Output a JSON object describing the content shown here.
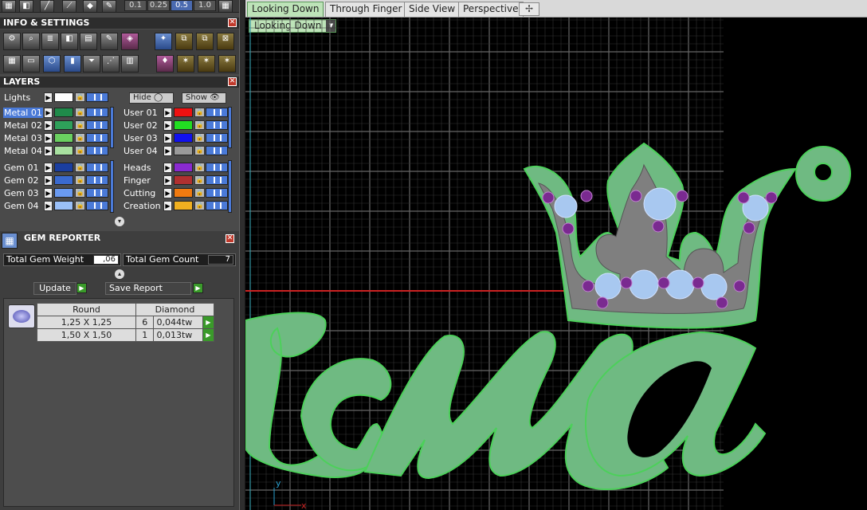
{
  "toolbar": {
    "zoom": [
      "0.1",
      "0.25",
      "0.5",
      "1.0"
    ],
    "zoom_selected": "0.5"
  },
  "info_settings": {
    "title": "INFO & SETTINGS",
    "close": "✕"
  },
  "layers": {
    "title": "LAYERS",
    "close": "✕",
    "lights_label": "Lights",
    "hide_label": "Hide",
    "show_label": "Show",
    "left": [
      {
        "label": "Metal 01",
        "color": "#1f8a4a",
        "selected": true
      },
      {
        "label": "Metal 02",
        "color": "#2ea05a"
      },
      {
        "label": "Metal 03",
        "color": "#6ad060"
      },
      {
        "label": "Metal 04",
        "color": "#a8e0a0"
      },
      {
        "label": "Gem 01",
        "color": "#1a3ea0"
      },
      {
        "label": "Gem 02",
        "color": "#3a6ad0"
      },
      {
        "label": "Gem 03",
        "color": "#6a9af0"
      },
      {
        "label": "Gem 04",
        "color": "#9ac0f8"
      }
    ],
    "right": [
      {
        "label": "User 01",
        "color": "#ee1111"
      },
      {
        "label": "User 02",
        "color": "#22dd22"
      },
      {
        "label": "User 03",
        "color": "#1111ee"
      },
      {
        "label": "User 04",
        "color": "#9a9a9a"
      },
      {
        "label": "Heads",
        "color": "#8a2ad0"
      },
      {
        "label": "Finger",
        "color": "#b03030"
      },
      {
        "label": "Cutting",
        "color": "#f07a10"
      },
      {
        "label": "Creation",
        "color": "#f0b020"
      }
    ]
  },
  "gem_reporter": {
    "title": "GEM REPORTER",
    "close": "✕",
    "weight_label": "Total Gem Weight",
    "weight_value": ",06",
    "count_label": "Total Gem Count",
    "count_value": "7",
    "update_label": "Update",
    "save_label": "Save Report",
    "table_headers": [
      "Round",
      "Diamond"
    ],
    "rows": [
      {
        "size": "1,25 X 1,25",
        "count": "6",
        "weight": "0,044tw"
      },
      {
        "size": "1,50 X 1,50",
        "count": "1",
        "weight": "0,013tw"
      }
    ]
  },
  "viewport": {
    "tabs": [
      "Looking Down",
      "Through Finger",
      "Side View",
      "Perspective"
    ],
    "active_tab": "Looking Down",
    "view_select": "Looking Down",
    "axis_y": "y",
    "axis_x": "x",
    "add_tab": "✢"
  },
  "colors": {
    "metal": "#6fba82",
    "metal_edge": "#4cd05a",
    "gem": "#a8c8f0",
    "gem_purple": "#7a2a90",
    "grid": "#555555",
    "red_axis": "#cc2222"
  }
}
